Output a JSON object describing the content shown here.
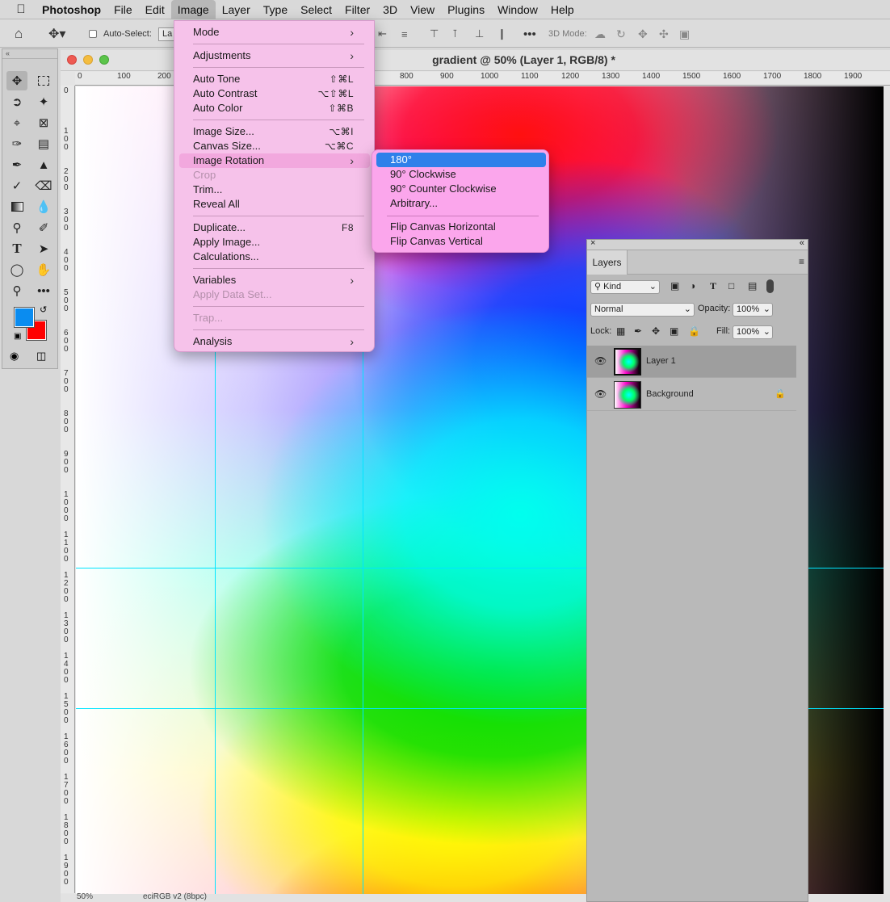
{
  "menubar": {
    "app": "Photoshop",
    "items": [
      "File",
      "Edit",
      "Image",
      "Layer",
      "Type",
      "Select",
      "Filter",
      "3D",
      "View",
      "Plugins",
      "Window",
      "Help"
    ]
  },
  "optionsbar": {
    "auto_select_label": "Auto-Select:",
    "auto_select_value": "La",
    "mode_3d_label": "3D Mode:"
  },
  "document": {
    "title": "gradient @ 50% (Layer 1, RGB/8) *",
    "zoom": "50%",
    "color_profile": "eciRGB v2 (8bpc)",
    "ruler_h": [
      "0",
      "100",
      "200",
      "800",
      "900",
      "1000",
      "1100",
      "1200",
      "1300",
      "1400",
      "1500",
      "1600",
      "1700",
      "1800",
      "1900"
    ],
    "ruler_v": [
      "0",
      "1 0 0",
      "2 0 0",
      "3 0 0",
      "4 0 0",
      "5 0 0",
      "6 0 0",
      "7 0 0",
      "8 0 0",
      "9 0 0",
      "1 0 0 0",
      "1 1 0 0",
      "1 2 0 0",
      "1 3 0 0",
      "1 4 0 0",
      "1 5 0 0",
      "1 6 0 0",
      "1 7 0 0",
      "1 8 0 0",
      "1 9 0 0"
    ]
  },
  "image_menu": {
    "items": [
      {
        "label": "Mode",
        "shortcut": "",
        "submenu": true,
        "disabled": false
      },
      {
        "label": "Adjustments",
        "shortcut": "",
        "submenu": true,
        "disabled": false
      },
      {
        "label": "Auto Tone",
        "shortcut": "⇧⌘L",
        "submenu": false,
        "disabled": false
      },
      {
        "label": "Auto Contrast",
        "shortcut": "⌥⇧⌘L",
        "submenu": false,
        "disabled": false
      },
      {
        "label": "Auto Color",
        "shortcut": "⇧⌘B",
        "submenu": false,
        "disabled": false
      },
      {
        "label": "Image Size...",
        "shortcut": "⌥⌘I",
        "submenu": false,
        "disabled": false
      },
      {
        "label": "Canvas Size...",
        "shortcut": "⌥⌘C",
        "submenu": false,
        "disabled": false
      },
      {
        "label": "Image Rotation",
        "shortcut": "",
        "submenu": true,
        "disabled": false
      },
      {
        "label": "Crop",
        "shortcut": "",
        "submenu": false,
        "disabled": true
      },
      {
        "label": "Trim...",
        "shortcut": "",
        "submenu": false,
        "disabled": false
      },
      {
        "label": "Reveal All",
        "shortcut": "",
        "submenu": false,
        "disabled": false
      },
      {
        "label": "Duplicate...",
        "shortcut": "F8",
        "submenu": false,
        "disabled": false
      },
      {
        "label": "Apply Image...",
        "shortcut": "",
        "submenu": false,
        "disabled": false
      },
      {
        "label": "Calculations...",
        "shortcut": "",
        "submenu": false,
        "disabled": false
      },
      {
        "label": "Variables",
        "shortcut": "",
        "submenu": true,
        "disabled": false
      },
      {
        "label": "Apply Data Set...",
        "shortcut": "",
        "submenu": false,
        "disabled": true
      },
      {
        "label": "Trap...",
        "shortcut": "",
        "submenu": false,
        "disabled": true
      },
      {
        "label": "Analysis",
        "shortcut": "",
        "submenu": true,
        "disabled": false
      }
    ]
  },
  "rotation_submenu": {
    "items": [
      "180°",
      "90° Clockwise",
      "90° Counter Clockwise",
      "Arbitrary...",
      "Flip Canvas Horizontal",
      "Flip Canvas Vertical"
    ]
  },
  "layers_panel": {
    "tab": "Layers",
    "filter_kind": "Kind",
    "blend_mode": "Normal",
    "opacity_label": "Opacity:",
    "opacity_value": "100%",
    "lock_label": "Lock:",
    "fill_label": "Fill:",
    "fill_value": "100%",
    "layers": [
      {
        "name": "Layer 1",
        "selected": true,
        "locked": false
      },
      {
        "name": "Background",
        "selected": false,
        "locked": true
      }
    ]
  },
  "colors": {
    "foreground": "#0a8cf0",
    "background": "#ff0000",
    "guide": "#00e5ff",
    "menu_highlight": "#2f80ea"
  }
}
